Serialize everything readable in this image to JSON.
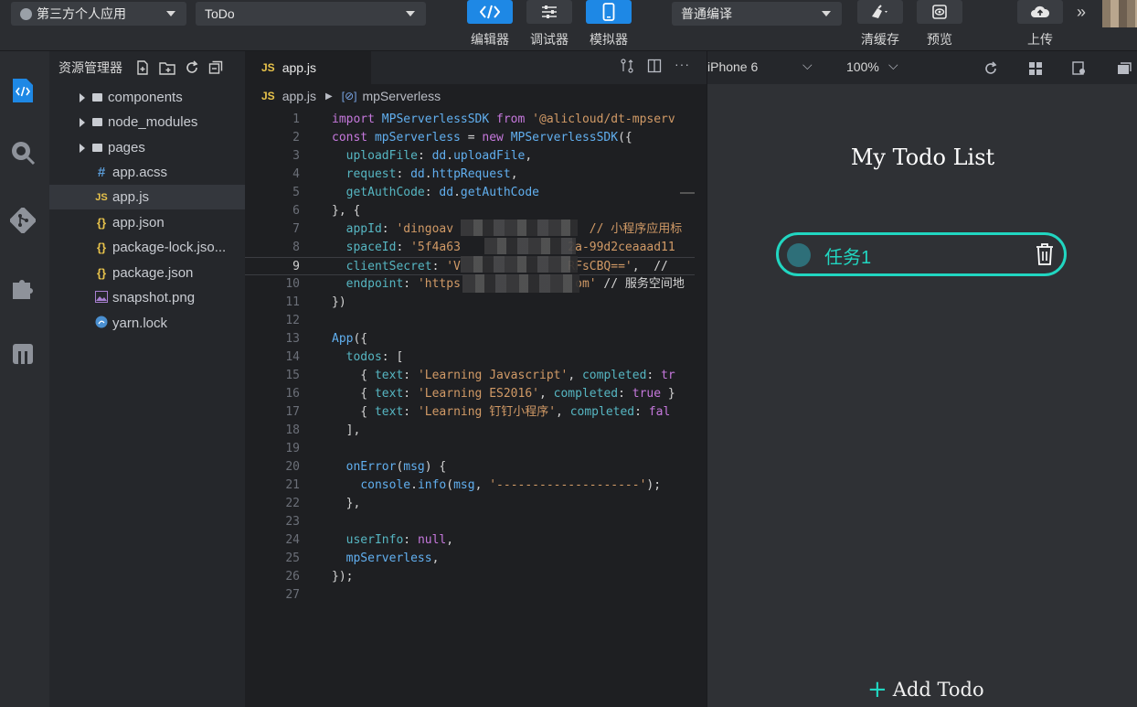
{
  "toolbar": {
    "project_select": "第三方个人应用",
    "app_select": "ToDo",
    "editor_label": "编辑器",
    "debugger_label": "调试器",
    "simulator_label": "模拟器",
    "compile_select": "普通编译",
    "clear_cache_label": "清缓存",
    "preview_label": "预览",
    "upload_label": "上传",
    "accent": "#1e88e5"
  },
  "explorer": {
    "title": "资源管理器",
    "items": [
      {
        "label": "components",
        "type": "folder"
      },
      {
        "label": "node_modules",
        "type": "folder"
      },
      {
        "label": "pages",
        "type": "folder"
      },
      {
        "label": "app.acss",
        "type": "acss",
        "glyph": "#"
      },
      {
        "label": "app.js",
        "type": "js",
        "glyph": "JS"
      },
      {
        "label": "app.json",
        "type": "json",
        "glyph": "{}"
      },
      {
        "label": "package-lock.jso...",
        "type": "json",
        "glyph": "{}"
      },
      {
        "label": "package.json",
        "type": "json",
        "glyph": "{}"
      },
      {
        "label": "snapshot.png",
        "type": "image"
      },
      {
        "label": "yarn.lock",
        "type": "lock"
      }
    ]
  },
  "editor": {
    "tab": "app.js",
    "tab_badge": "JS",
    "breadcrumb_file": "app.js",
    "breadcrumb_symbol": "mpServerless",
    "current_line": 9,
    "lines": [
      "import MPServerlessSDK from '@alicloud/dt-mpserv",
      "const mpServerless = new MPServerlessSDK({",
      "  uploadFile: dd.uploadFile,",
      "  request: dd.httpRequest,",
      "  getAuthCode: dd.getAuthCode",
      "}, {",
      "  appId: 'dingoav                   // 小程序应用标",
      "  spaceId: '5f4a63               2a-99d2ceaaad11",
      "  clientSecret: 'V               RFsCBQ==',  //",
      "  endpoint: 'https                om' // 服务空间地",
      "})",
      "",
      "App({",
      "  todos: [",
      "    { text: 'Learning Javascript', completed: tr",
      "    { text: 'Learning ES2016', completed: true }",
      "    { text: 'Learning 钉钉小程序', completed: fal",
      "  ],",
      "",
      "  onError(msg) {",
      "    console.info(msg, '--------------------');",
      "  },",
      "",
      "  userInfo: null,",
      "  mpServerless,",
      "});",
      ""
    ]
  },
  "simulator": {
    "device": "iPhone 6",
    "zoom": "100%",
    "title": "My Todo List",
    "todos": [
      {
        "text": "任务1",
        "completed": false
      }
    ],
    "add_label": "Add Todo",
    "accent": "#21d6c1"
  }
}
